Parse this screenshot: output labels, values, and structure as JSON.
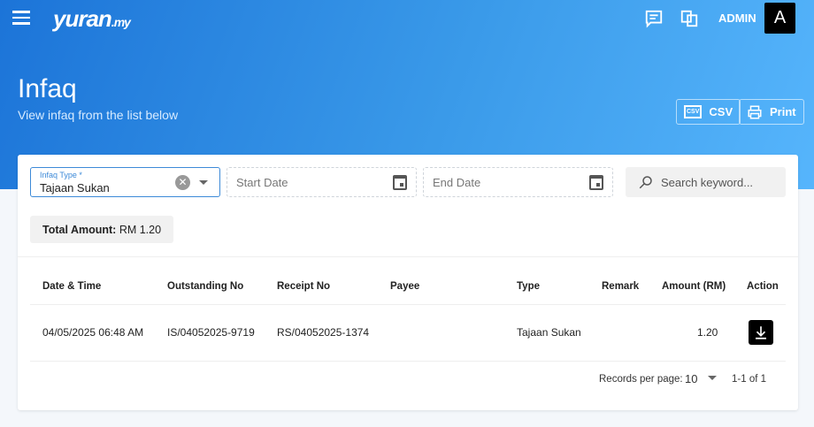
{
  "header": {
    "logo": "yuran",
    "logo_suffix": ".my",
    "user": "ADMIN",
    "avatar": "A"
  },
  "page": {
    "title": "Infaq",
    "subtitle": "View infaq from the list below",
    "csv": "CSV",
    "print": "Print"
  },
  "filters": {
    "type_label": "Infaq Type *",
    "type_value": "Tajaan Sukan",
    "start": "Start Date",
    "end": "End Date",
    "search": "Search keyword..."
  },
  "total": {
    "label": "Total Amount:",
    "value": "RM 1.20"
  },
  "table": {
    "headers": [
      "Date & Time",
      "Outstanding No",
      "Receipt No",
      "Payee",
      "Type",
      "Remark",
      "Amount (RM)",
      "Action"
    ],
    "rows": [
      {
        "date": "04/05/2025 06:48 AM",
        "outstanding": "IS/04052025-9719",
        "receipt": "RS/04052025-1374",
        "payee": "",
        "type": "Tajaan Sukan",
        "remark": "",
        "amount": "1.20"
      }
    ]
  },
  "pagination": {
    "label": "Records per page:",
    "per_page": "10",
    "range": "1-1 of 1"
  }
}
